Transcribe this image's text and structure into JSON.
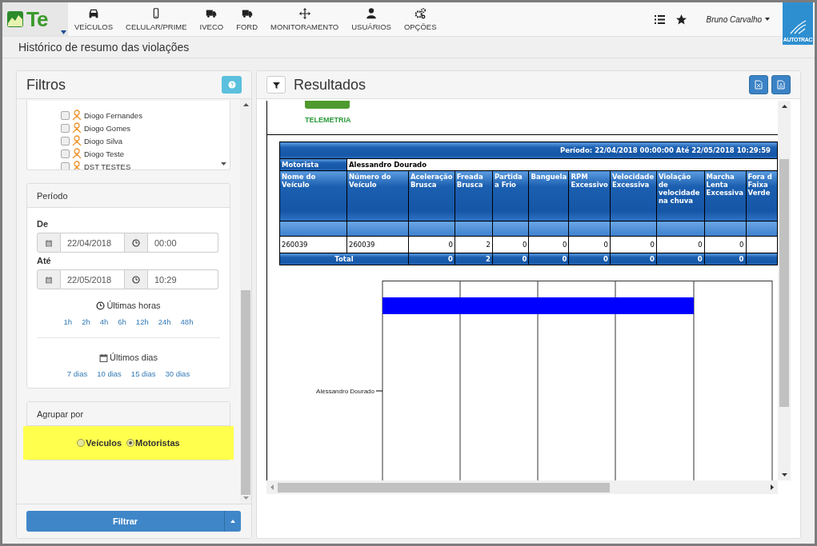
{
  "nav": {
    "brand": "Te",
    "items": [
      {
        "label": "VEÍCULOS",
        "kind": "car"
      },
      {
        "label": "CELULAR/PRIME",
        "kind": "phone"
      },
      {
        "label": "IVECO",
        "kind": "truck"
      },
      {
        "label": "FORD",
        "kind": "truck"
      },
      {
        "label": "MONITORAMENTO",
        "kind": "move"
      },
      {
        "label": "USUÁRIOS",
        "kind": "user"
      },
      {
        "label": "OPÇÕES",
        "kind": "gears"
      }
    ],
    "user": "Bruno Carvalho",
    "partner": "AUTOTRAC"
  },
  "page_title": "Histórico de resumo das violações",
  "filters": {
    "title": "Filtros",
    "drivers": [
      {
        "name": "Diogo Fernandes",
        "checked": false
      },
      {
        "name": "Diogo Gomes",
        "checked": false
      },
      {
        "name": "Diogo Silva",
        "checked": false
      },
      {
        "name": "Diogo Teste",
        "checked": false
      },
      {
        "name": "DST TESTES",
        "checked": false
      }
    ],
    "period": {
      "title": "Período",
      "from_label": "De",
      "from_date": "22/04/2018",
      "from_time": "00:00",
      "to_label": "Até",
      "to_date": "22/05/2018",
      "to_time": "10:29",
      "hours_title": "Últimas horas",
      "hours": [
        "1h",
        "2h",
        "4h",
        "6h",
        "12h",
        "24h",
        "48h"
      ],
      "days_title": "Últimos dias",
      "days": [
        "7 dias",
        "10 dias",
        "15 dias",
        "30 dias"
      ]
    },
    "group_by": {
      "title": "Agrupar por",
      "options": [
        {
          "label": "Veículos",
          "selected": false
        },
        {
          "label": "Motoristas",
          "selected": true
        }
      ]
    },
    "filter_button": "Filtrar"
  },
  "results": {
    "title": "Resultados",
    "report": {
      "brand": "TELEMETRIA",
      "period": "Período: 22/04/2018 00:00:00 Até 22/05/2018 10:29:59",
      "driver_label": "Motorista",
      "driver": "Alessandro Dourado",
      "columns": [
        "Nome do Veículo",
        "Número do Veículo",
        "Aceleração Brusca",
        "Freada Brusca",
        "Partida a Frio",
        "Banguela",
        "RPM Excessivo",
        "Velocidade Excessiva",
        "Violação de velocidade na chuva",
        "Marcha Lenta Excessiva",
        "Fora d Faixa Verde"
      ],
      "rows": [
        [
          "260039",
          "260039",
          "0",
          "2",
          "0",
          "0",
          "0",
          "0",
          "0",
          "0"
        ]
      ],
      "total_label": "Total",
      "totals": [
        "0",
        "2",
        "0",
        "0",
        "0",
        "0",
        "0",
        "0"
      ]
    },
    "chart": {
      "category_label": "Alessandro Dourado"
    }
  }
}
